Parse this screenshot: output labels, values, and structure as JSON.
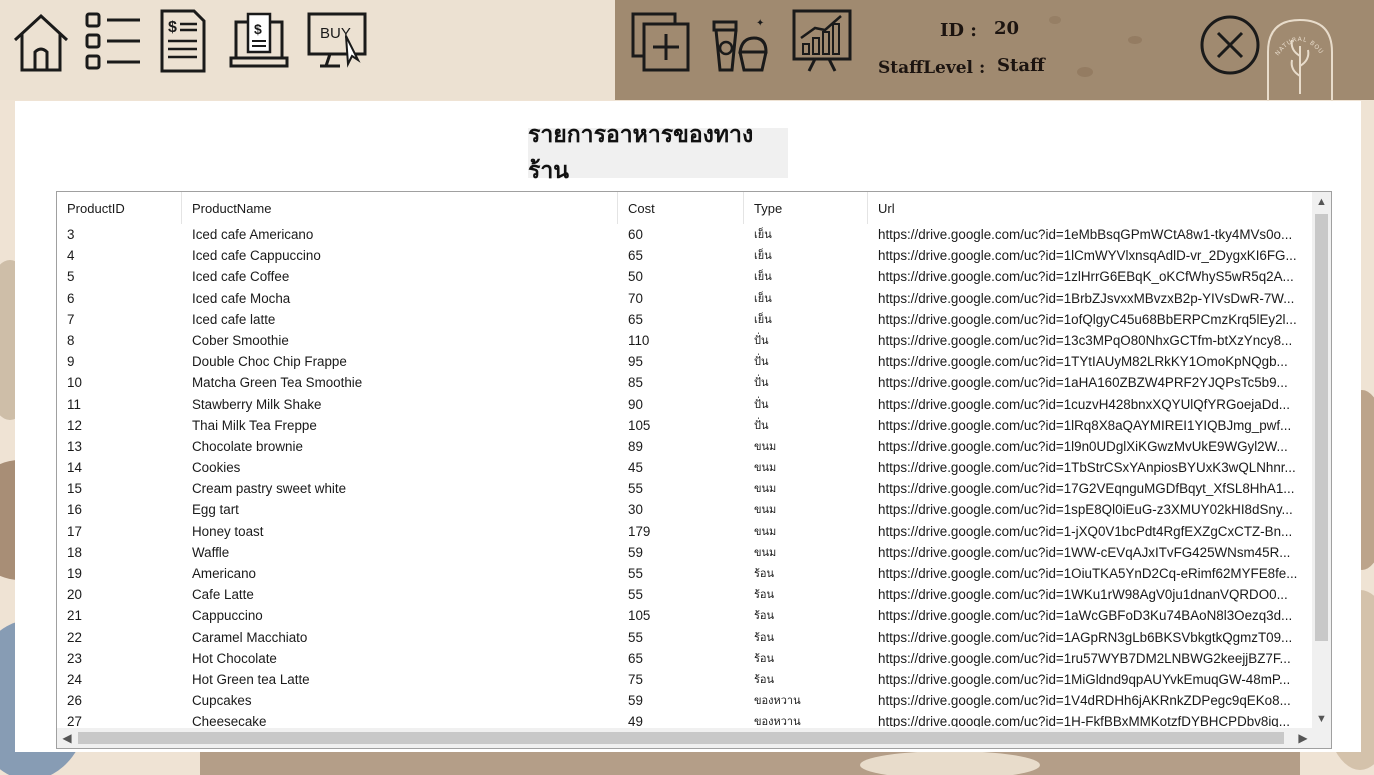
{
  "header": {
    "id_label": "ID :",
    "id_value": "20",
    "staff_level_label": "StaffLevel :",
    "staff_level_value": "Staff",
    "buy_label": "BUY",
    "logo_text": "NATURAL BOUTIQUE"
  },
  "panel": {
    "title": "รายการอาหารของทางร้าน"
  },
  "grid": {
    "columns": [
      "ProductID",
      "ProductName",
      "Cost",
      "Type",
      "Url"
    ],
    "rows": [
      [
        "3",
        "Iced cafe Americano",
        "60",
        "เย็น",
        "https://drive.google.com/uc?id=1eMbBsqGPmWCtA8w1-tky4MVs0o..."
      ],
      [
        "4",
        "Iced cafe Cappuccino",
        "65",
        "เย็น",
        "https://drive.google.com/uc?id=1lCmWYVlxnsqAdlD-vr_2DygxKI6FG..."
      ],
      [
        "5",
        "Iced cafe Coffee",
        "50",
        "เย็น",
        "https://drive.google.com/uc?id=1zlHrrG6EBqK_oKCfWhyS5wR5q2A..."
      ],
      [
        "6",
        "Iced cafe Mocha",
        "70",
        "เย็น",
        "https://drive.google.com/uc?id=1BrbZJsvxxMBvzxB2p-YIVsDwR-7W..."
      ],
      [
        "7",
        "Iced cafe latte",
        "65",
        "เย็น",
        "https://drive.google.com/uc?id=1ofQlgyC45u68BbERPCmzKrq5lEy2l..."
      ],
      [
        "8",
        "Cober Smoothie",
        "110",
        "ปั่น",
        "https://drive.google.com/uc?id=13c3MPqO80NhxGCTfm-btXzYncy8..."
      ],
      [
        "9",
        "Double Choc Chip Frappe",
        "95",
        "ปั่น",
        "https://drive.google.com/uc?id=1TYtIAUyM82LRkKY1OmoKpNQgb..."
      ],
      [
        "10",
        "Matcha Green Tea Smoothie",
        "85",
        "ปั่น",
        "https://drive.google.com/uc?id=1aHA160ZBZW4PRF2YJQPsTc5b9..."
      ],
      [
        "11",
        "Stawberry Milk Shake",
        "90",
        "ปั่น",
        "https://drive.google.com/uc?id=1cuzvH428bnxXQYUlQfYRGoejaDd..."
      ],
      [
        "12",
        "Thai Milk Tea Freppe",
        "105",
        "ปั่น",
        "https://drive.google.com/uc?id=1lRq8X8aQAYMIREI1YIQBJmg_pwf..."
      ],
      [
        "13",
        "Chocolate brownie",
        "89",
        "ขนม",
        "https://drive.google.com/uc?id=1l9n0UDglXiKGwzMvUkE9WGyl2W..."
      ],
      [
        "14",
        "Cookies",
        "45",
        "ขนม",
        "https://drive.google.com/uc?id=1TbStrCSxYAnpiosBYUxK3wQLNhnr..."
      ],
      [
        "15",
        "Cream pastry sweet white",
        "55",
        "ขนม",
        "https://drive.google.com/uc?id=17G2VEqnguMGDfBqyt_XfSL8HhA1..."
      ],
      [
        "16",
        "Egg tart",
        "30",
        "ขนม",
        "https://drive.google.com/uc?id=1spE8Ql0iEuG-z3XMUY02kHI8dSny..."
      ],
      [
        "17",
        "Honey toast",
        "179",
        "ขนม",
        "https://drive.google.com/uc?id=1-jXQ0V1bcPdt4RgfEXZgCxCTZ-Bn..."
      ],
      [
        "18",
        "Waffle",
        "59",
        "ขนม",
        "https://drive.google.com/uc?id=1WW-cEVqAJxITvFG425WNsm45R..."
      ],
      [
        "19",
        "Americano",
        "55",
        "ร้อน",
        "https://drive.google.com/uc?id=1OiuTKA5YnD2Cq-eRimf62MYFE8fe..."
      ],
      [
        "20",
        "Cafe Latte",
        "55",
        "ร้อน",
        "https://drive.google.com/uc?id=1WKu1rW98AgV0ju1dnanVQRDO0..."
      ],
      [
        "21",
        "Cappuccino",
        "105",
        "ร้อน",
        "https://drive.google.com/uc?id=1aWcGBFoD3Ku74BAoN8l3Oezq3d..."
      ],
      [
        "22",
        "Caramel Macchiato",
        "55",
        "ร้อน",
        "https://drive.google.com/uc?id=1AGpRN3gLb6BKSVbkgtkQgmzT09..."
      ],
      [
        "23",
        "Hot Chocolate",
        "65",
        "ร้อน",
        "https://drive.google.com/uc?id=1ru57WYB7DM2LNBWG2keejjBZ7F..."
      ],
      [
        "24",
        "Hot Green tea Latte",
        "75",
        "ร้อน",
        "https://drive.google.com/uc?id=1MiGldnd9qpAUYvkEmuqGW-48mP..."
      ],
      [
        "26",
        "Cupcakes",
        "59",
        "ของหวาน",
        "https://drive.google.com/uc?id=1V4dRDHh6jAKRnkZDPegc9qEKo8..."
      ],
      [
        "27",
        "Cheesecake",
        "49",
        "ของหวาน",
        "https://drive.google.com/uc?id=1H-FkfBBxMMKotzfDYBHCPDbv8iq..."
      ]
    ]
  },
  "colors": {
    "topbar_left": "#ece1d2",
    "topbar_right": "#a08a70",
    "panel": "#ffffff",
    "title_bg": "#f0f0f0"
  }
}
